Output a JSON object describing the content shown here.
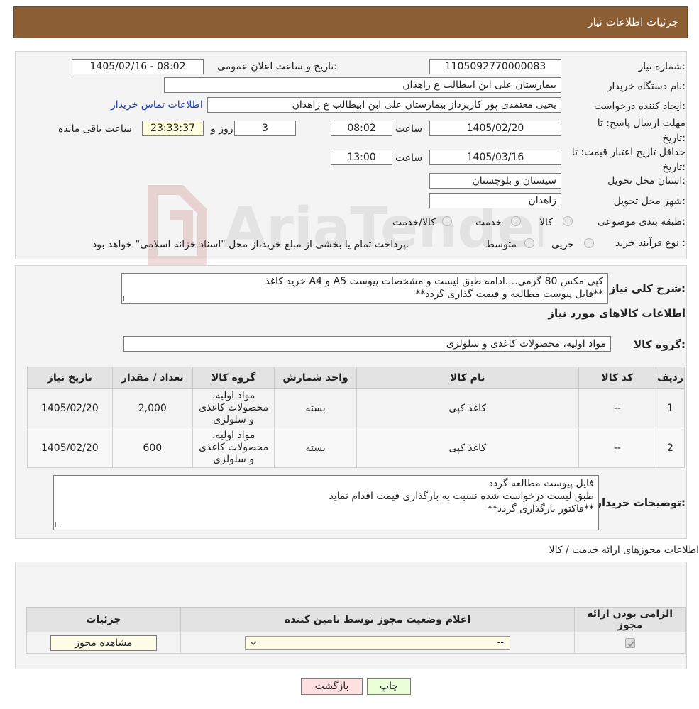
{
  "header": {
    "title": "جزئیات اطلاعات نیاز"
  },
  "form": {
    "need_number_label": "شماره نیاز:",
    "need_number": "1105092770000083",
    "announce_label": "تاریخ و ساعت اعلان عمومی:",
    "announce_value": "1405/02/16 - 08:02",
    "buyer_org_label": "نام دستگاه خریدار:",
    "buyer_org": "بیمارستان علی ابن ابیطالب  ع  زاهدان",
    "requester_label": "ایجاد کننده درخواست:",
    "requester": "یحیی معتمدی پور کارپرداز بیمارستان علی ابن ابیطالب  ع  زاهدان",
    "contact_link": "اطلاعات تماس خریدار",
    "reply_deadline_label": "مهلت ارسال پاسخ: تا تاریخ:",
    "reply_date": "1405/02/20",
    "time_label": "ساعت",
    "reply_time": "08:02",
    "days_value": "3",
    "days_label": "روز و",
    "remaining_value": "23:33:37",
    "remaining_label": "ساعت باقی مانده",
    "price_validity_label": "حداقل تاریخ اعتبار قیمت: تا تاریخ:",
    "price_date": "1405/03/16",
    "price_time": "13:00",
    "province_label": "استان محل تحویل:",
    "province": "سیستان و بلوچستان",
    "city_label": "شهر محل تحویل:",
    "city": "زاهدان",
    "category_label": "طبقه بندی موضوعی:",
    "category_options": [
      "کالا",
      "خدمت",
      "کالا/خدمت"
    ],
    "purchase_type_label": "نوع فرآیند خرید :",
    "purchase_type_options": [
      "جزیی",
      "متوسط"
    ],
    "purchase_note": "پرداخت تمام یا بخشی از مبلغ خرید،از محل \"اسناد خزانه اسلامی\" خواهد بود."
  },
  "description": {
    "label": "شرح کلی نیاز:",
    "line1": "خرید کاغذ A4 و A5 کپی مکس 80 گرمی....ادامه طبق لیست و مشخصات پیوست",
    "line2": "**فایل پیوست مطالعه و قیمت گذاری گردد**"
  },
  "goods": {
    "section_title": "اطلاعات کالاهای مورد نیاز",
    "group_label": "گروه کالا:",
    "group_value": "مواد اولیه، محصولات کاغذی و سلولزی",
    "columns": [
      "ردیف",
      "کد کالا",
      "نام کالا",
      "واحد شمارش",
      "گروه کالا",
      "تعداد / مقدار",
      "تاریخ نیاز"
    ],
    "rows": [
      {
        "row": "1",
        "code": "--",
        "name": "کاغذ کپی",
        "unit": "بسته",
        "group": "مواد اولیه، محصولات کاغذی و سلولزی",
        "qty": "2,000",
        "date": "1405/02/20"
      },
      {
        "row": "2",
        "code": "--",
        "name": "کاغذ کپی",
        "unit": "بسته",
        "group": "مواد اولیه، محصولات کاغذی و سلولزی",
        "qty": "600",
        "date": "1405/02/20"
      }
    ]
  },
  "buyer_notes": {
    "label": "توضیحات خریدار:",
    "line1": "فایل پیوست مطالعه گردد",
    "line2": "طبق لیست درخواست شده نسبت به بارگذاری قیمت اقدام نماید",
    "line3": "**فاکتور بارگذاری گردد**"
  },
  "permits": {
    "section_title": "اطلاعات مجوزهای ارائه خدمت / کالا",
    "columns": [
      "الزامی بودن ارائه مجوز",
      "اعلام وضعیت مجوز توسط تامین کننده",
      "جزئیات"
    ],
    "select_value": "--",
    "view_button": "مشاهده مجوز"
  },
  "actions": {
    "print": "چاپ",
    "back": "بازگشت"
  },
  "watermark": "AriaTender.neT"
}
